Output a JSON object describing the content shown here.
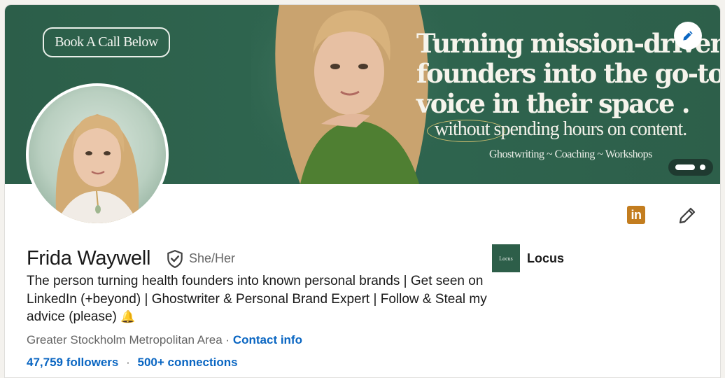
{
  "banner": {
    "book_label": "Book A Call Below",
    "headline_lines": [
      "Turning mission-driven",
      "founders into the go-to",
      "voice in their space ."
    ],
    "tagline": "without spending hours on content.",
    "services": "Ghostwriting ~ Coaching ~ Workshops",
    "edit_icon": "pencil-icon",
    "colors": {
      "background": "#2f6650",
      "text": "#f6f4ec",
      "oval": "#cdbd6f"
    }
  },
  "profile": {
    "name": "Frida Waywell",
    "verified_icon": "shield-check-icon",
    "pronouns": "She/Her",
    "bio": "The person turning health founders into known personal brands | Get seen on LinkedIn (+beyond) | Ghostwriter & Personal Brand Expert | Follow & Steal my advice (please)",
    "bio_emoji": "🔔",
    "location": "Greater Stockholm Metropolitan Area",
    "location_sep": "·",
    "contact_label": "Contact info",
    "followers": "47,759 followers",
    "stats_sep": "·",
    "connections": "500+ connections"
  },
  "actions": {
    "linkedin_badge": "in",
    "edit_icon": "pencil-icon"
  },
  "company": {
    "logo_text": "Locus",
    "name": "Locus"
  },
  "colors": {
    "link": "#0a66c2",
    "linkedin_badge": "#c37d1f",
    "brand_green": "#2d5e49"
  }
}
